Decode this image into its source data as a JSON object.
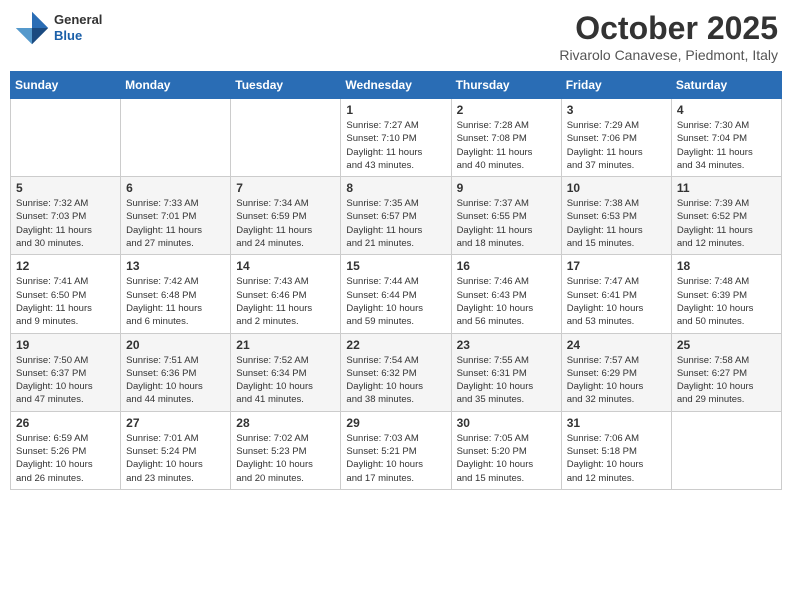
{
  "header": {
    "logo": {
      "general": "General",
      "blue": "Blue"
    },
    "title": "October 2025",
    "subtitle": "Rivarolo Canavese, Piedmont, Italy"
  },
  "days_of_week": [
    "Sunday",
    "Monday",
    "Tuesday",
    "Wednesday",
    "Thursday",
    "Friday",
    "Saturday"
  ],
  "weeks": [
    [
      {
        "day": "",
        "info": ""
      },
      {
        "day": "",
        "info": ""
      },
      {
        "day": "",
        "info": ""
      },
      {
        "day": "1",
        "info": "Sunrise: 7:27 AM\nSunset: 7:10 PM\nDaylight: 11 hours\nand 43 minutes."
      },
      {
        "day": "2",
        "info": "Sunrise: 7:28 AM\nSunset: 7:08 PM\nDaylight: 11 hours\nand 40 minutes."
      },
      {
        "day": "3",
        "info": "Sunrise: 7:29 AM\nSunset: 7:06 PM\nDaylight: 11 hours\nand 37 minutes."
      },
      {
        "day": "4",
        "info": "Sunrise: 7:30 AM\nSunset: 7:04 PM\nDaylight: 11 hours\nand 34 minutes."
      }
    ],
    [
      {
        "day": "5",
        "info": "Sunrise: 7:32 AM\nSunset: 7:03 PM\nDaylight: 11 hours\nand 30 minutes."
      },
      {
        "day": "6",
        "info": "Sunrise: 7:33 AM\nSunset: 7:01 PM\nDaylight: 11 hours\nand 27 minutes."
      },
      {
        "day": "7",
        "info": "Sunrise: 7:34 AM\nSunset: 6:59 PM\nDaylight: 11 hours\nand 24 minutes."
      },
      {
        "day": "8",
        "info": "Sunrise: 7:35 AM\nSunset: 6:57 PM\nDaylight: 11 hours\nand 21 minutes."
      },
      {
        "day": "9",
        "info": "Sunrise: 7:37 AM\nSunset: 6:55 PM\nDaylight: 11 hours\nand 18 minutes."
      },
      {
        "day": "10",
        "info": "Sunrise: 7:38 AM\nSunset: 6:53 PM\nDaylight: 11 hours\nand 15 minutes."
      },
      {
        "day": "11",
        "info": "Sunrise: 7:39 AM\nSunset: 6:52 PM\nDaylight: 11 hours\nand 12 minutes."
      }
    ],
    [
      {
        "day": "12",
        "info": "Sunrise: 7:41 AM\nSunset: 6:50 PM\nDaylight: 11 hours\nand 9 minutes."
      },
      {
        "day": "13",
        "info": "Sunrise: 7:42 AM\nSunset: 6:48 PM\nDaylight: 11 hours\nand 6 minutes."
      },
      {
        "day": "14",
        "info": "Sunrise: 7:43 AM\nSunset: 6:46 PM\nDaylight: 11 hours\nand 2 minutes."
      },
      {
        "day": "15",
        "info": "Sunrise: 7:44 AM\nSunset: 6:44 PM\nDaylight: 10 hours\nand 59 minutes."
      },
      {
        "day": "16",
        "info": "Sunrise: 7:46 AM\nSunset: 6:43 PM\nDaylight: 10 hours\nand 56 minutes."
      },
      {
        "day": "17",
        "info": "Sunrise: 7:47 AM\nSunset: 6:41 PM\nDaylight: 10 hours\nand 53 minutes."
      },
      {
        "day": "18",
        "info": "Sunrise: 7:48 AM\nSunset: 6:39 PM\nDaylight: 10 hours\nand 50 minutes."
      }
    ],
    [
      {
        "day": "19",
        "info": "Sunrise: 7:50 AM\nSunset: 6:37 PM\nDaylight: 10 hours\nand 47 minutes."
      },
      {
        "day": "20",
        "info": "Sunrise: 7:51 AM\nSunset: 6:36 PM\nDaylight: 10 hours\nand 44 minutes."
      },
      {
        "day": "21",
        "info": "Sunrise: 7:52 AM\nSunset: 6:34 PM\nDaylight: 10 hours\nand 41 minutes."
      },
      {
        "day": "22",
        "info": "Sunrise: 7:54 AM\nSunset: 6:32 PM\nDaylight: 10 hours\nand 38 minutes."
      },
      {
        "day": "23",
        "info": "Sunrise: 7:55 AM\nSunset: 6:31 PM\nDaylight: 10 hours\nand 35 minutes."
      },
      {
        "day": "24",
        "info": "Sunrise: 7:57 AM\nSunset: 6:29 PM\nDaylight: 10 hours\nand 32 minutes."
      },
      {
        "day": "25",
        "info": "Sunrise: 7:58 AM\nSunset: 6:27 PM\nDaylight: 10 hours\nand 29 minutes."
      }
    ],
    [
      {
        "day": "26",
        "info": "Sunrise: 6:59 AM\nSunset: 5:26 PM\nDaylight: 10 hours\nand 26 minutes."
      },
      {
        "day": "27",
        "info": "Sunrise: 7:01 AM\nSunset: 5:24 PM\nDaylight: 10 hours\nand 23 minutes."
      },
      {
        "day": "28",
        "info": "Sunrise: 7:02 AM\nSunset: 5:23 PM\nDaylight: 10 hours\nand 20 minutes."
      },
      {
        "day": "29",
        "info": "Sunrise: 7:03 AM\nSunset: 5:21 PM\nDaylight: 10 hours\nand 17 minutes."
      },
      {
        "day": "30",
        "info": "Sunrise: 7:05 AM\nSunset: 5:20 PM\nDaylight: 10 hours\nand 15 minutes."
      },
      {
        "day": "31",
        "info": "Sunrise: 7:06 AM\nSunset: 5:18 PM\nDaylight: 10 hours\nand 12 minutes."
      },
      {
        "day": "",
        "info": ""
      }
    ]
  ]
}
